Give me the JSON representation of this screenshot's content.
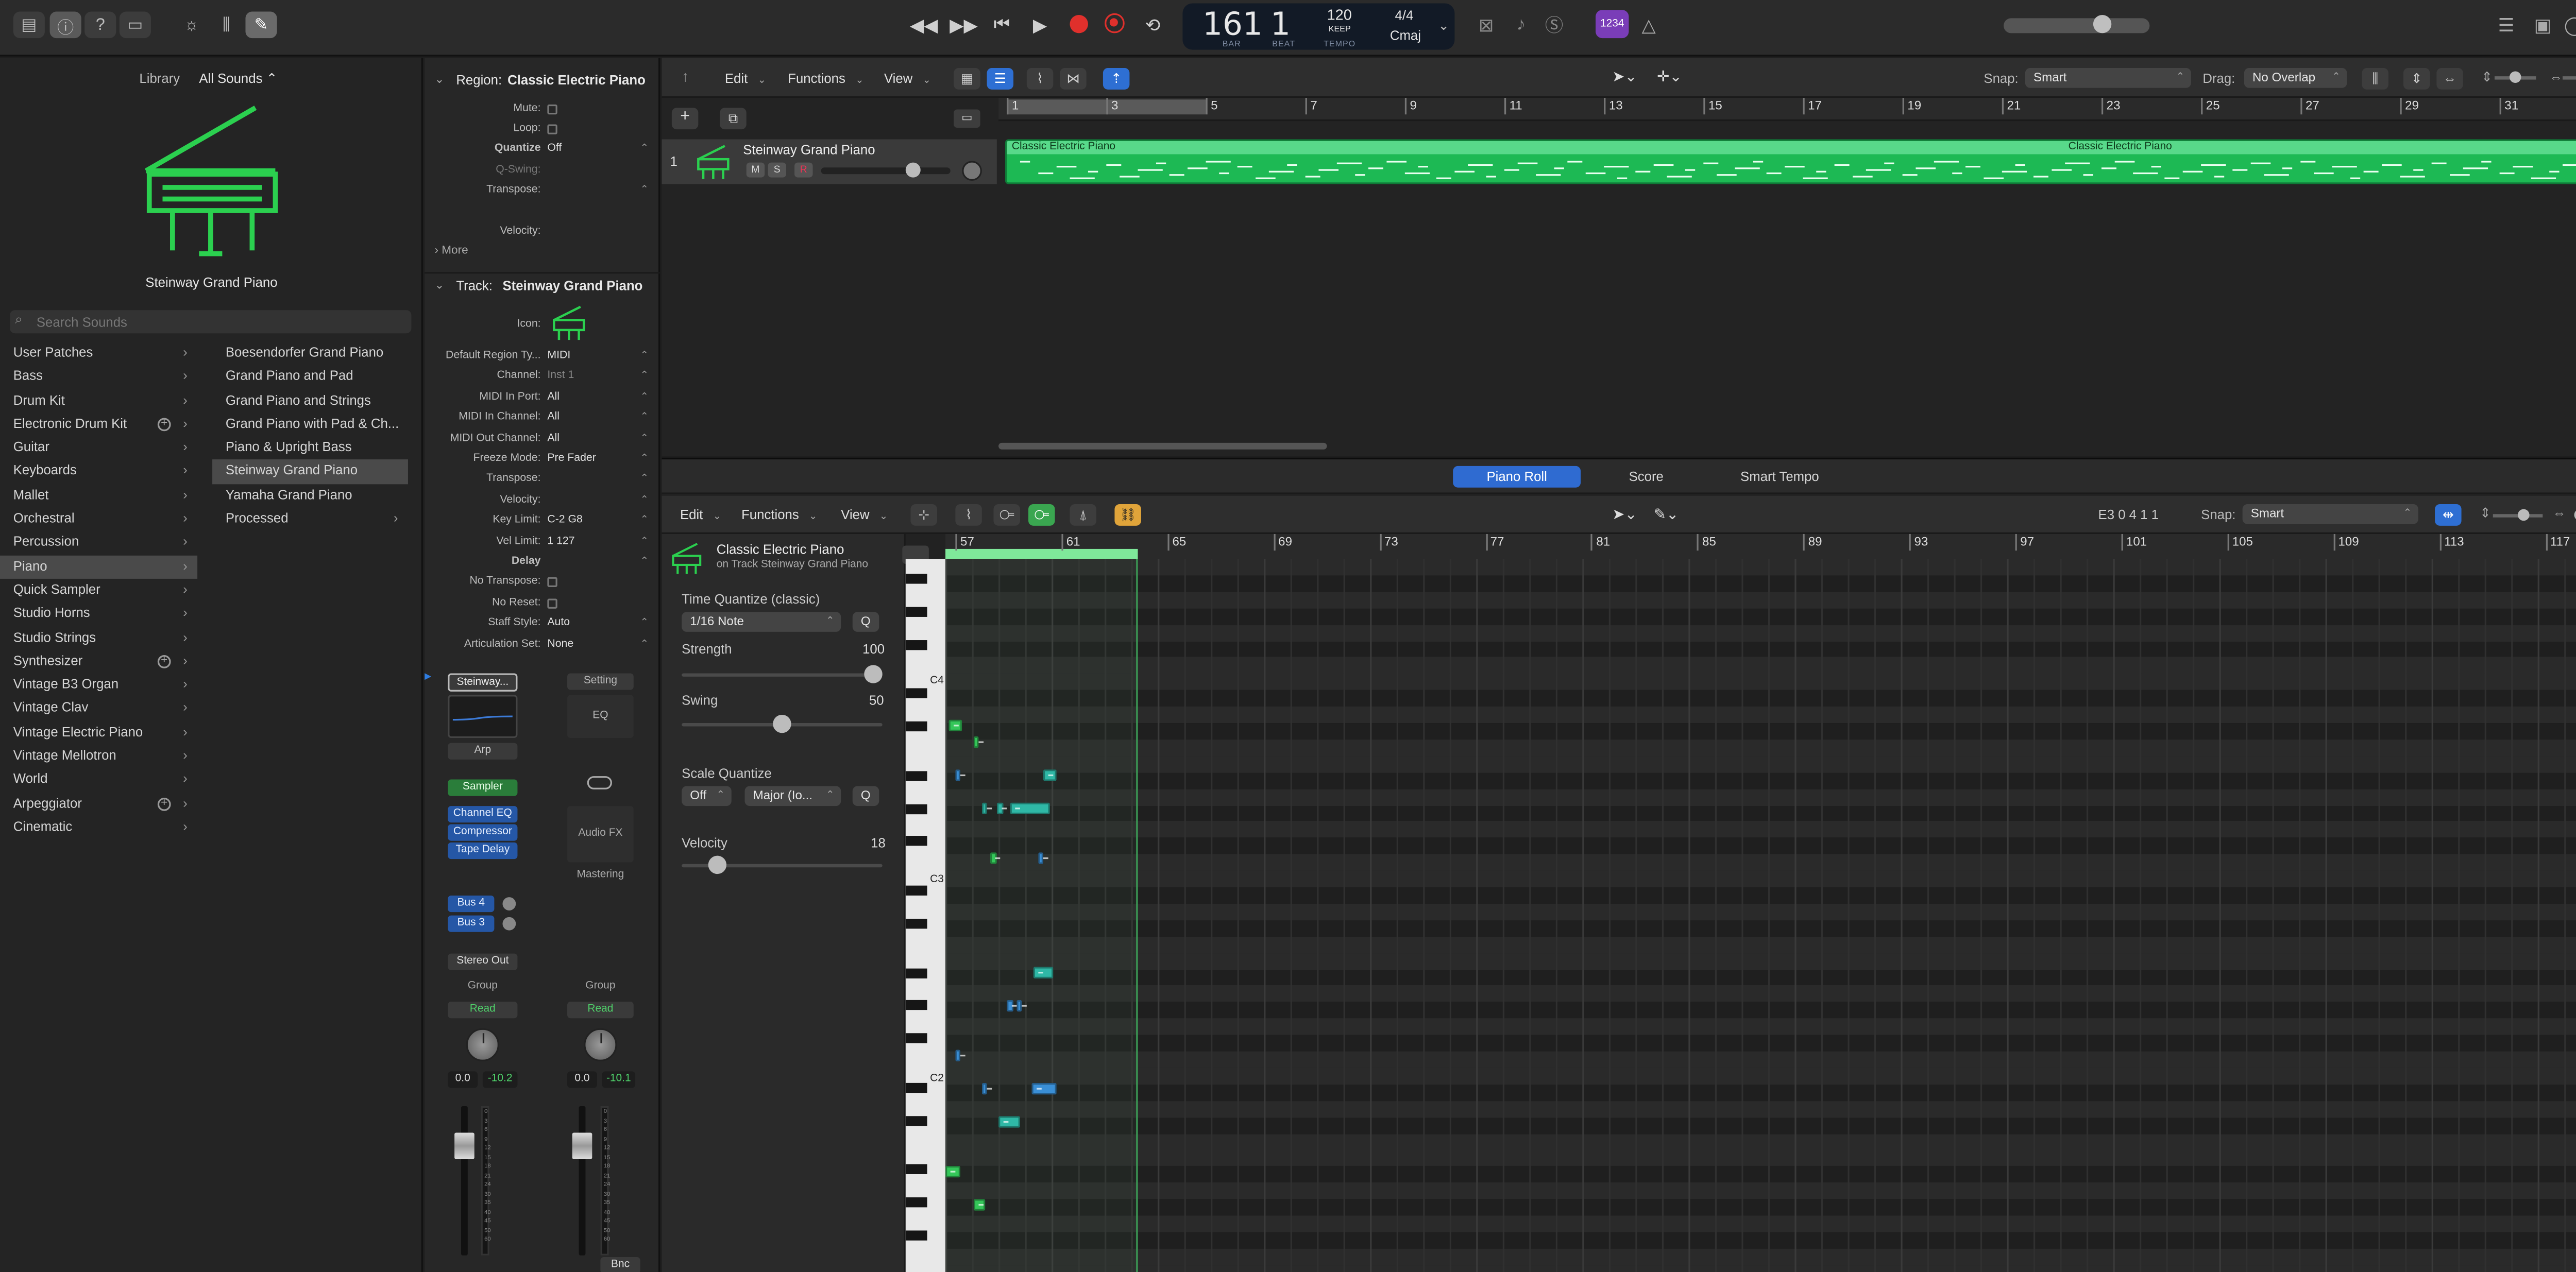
{
  "control_bar": {
    "icons": [
      "library-icon",
      "inspector-icon",
      "help-icon",
      "toolbar-icon",
      "smart-controls-icon",
      "mixer-icon",
      "editors-icon"
    ],
    "transport": [
      "rewind-icon",
      "fast-forward-icon",
      "go-to-beginning-icon",
      "play-icon",
      "record-icon",
      "capture-record-icon",
      "cycle-icon"
    ],
    "lcd": {
      "bar": "161",
      "beat": "1",
      "bar_label": "BAR",
      "beat_label": "BEAT",
      "tempo": "120",
      "tempo_mode": "KEEP",
      "tempo_label": "TEMPO",
      "signature": "4/4",
      "key": "Cmaj"
    },
    "right_badge": "1234"
  },
  "library": {
    "header_label": "Library",
    "header_value": "All Sounds",
    "selected_name": "Steinway Grand Piano",
    "search_placeholder": "Search Sounds",
    "categories": [
      {
        "label": "User Patches"
      },
      {
        "label": "Bass"
      },
      {
        "label": "Drum Kit"
      },
      {
        "label": "Electronic Drum Kit",
        "plus": true
      },
      {
        "label": "Guitar"
      },
      {
        "label": "Keyboards"
      },
      {
        "label": "Mallet"
      },
      {
        "label": "Orchestral"
      },
      {
        "label": "Percussion"
      },
      {
        "label": "Piano",
        "selected": true
      },
      {
        "label": "Quick Sampler"
      },
      {
        "label": "Studio Horns"
      },
      {
        "label": "Studio Strings"
      },
      {
        "label": "Synthesizer",
        "plus": true
      },
      {
        "label": "Vintage B3 Organ"
      },
      {
        "label": "Vintage Clav"
      },
      {
        "label": "Vintage Electric Piano"
      },
      {
        "label": "Vintage Mellotron"
      },
      {
        "label": "World"
      },
      {
        "label": "Arpeggiator",
        "plus": true
      },
      {
        "label": "Cinematic"
      }
    ],
    "patches": [
      {
        "label": "Boesendorfer Grand Piano"
      },
      {
        "label": "Grand Piano and Pad"
      },
      {
        "label": "Grand Piano and Strings"
      },
      {
        "label": "Grand Piano with Pad & Ch..."
      },
      {
        "label": "Piano & Upright Bass"
      },
      {
        "label": "Steinway Grand Piano",
        "selected": true
      },
      {
        "label": "Yamaha Grand Piano"
      },
      {
        "label": "Processed",
        "chevron": true
      }
    ]
  },
  "inspector": {
    "region_header": "Region:",
    "region_name": "Classic Electric Piano",
    "region_rows": [
      {
        "label": "Mute:",
        "type": "check"
      },
      {
        "label": "Loop:",
        "type": "check"
      },
      {
        "label": "Quantize",
        "value": "Off",
        "type": "popup",
        "bold": true
      },
      {
        "label": "Q-Swing:",
        "value": "",
        "type": "dim"
      },
      {
        "label": "Transpose:",
        "value": "",
        "type": "popup"
      },
      {
        "label": "Velocity:",
        "value": "",
        "type": "plain"
      }
    ],
    "more_label": "More",
    "track_header": "Track:",
    "track_name": "Steinway Grand Piano",
    "icon_label": "Icon:",
    "track_rows": [
      {
        "label": "Default Region Ty...",
        "value": "MIDI"
      },
      {
        "label": "Channel:",
        "value": "Inst 1",
        "dim": true
      },
      {
        "label": "MIDI In Port:",
        "value": "All"
      },
      {
        "label": "MIDI In Channel:",
        "value": "All"
      },
      {
        "label": "MIDI Out Channel:",
        "value": "All"
      },
      {
        "label": "Freeze Mode:",
        "value": "Pre Fader"
      },
      {
        "label": "Transpose:",
        "value": ""
      },
      {
        "label": "Velocity:",
        "value": ""
      },
      {
        "label": "Key Limit:",
        "value": "C-2  G8"
      },
      {
        "label": "Vel Limit:",
        "value": "1  127"
      },
      {
        "label": "Delay",
        "value": "",
        "bold": true
      },
      {
        "label": "No Transpose:",
        "value": "",
        "check": true
      },
      {
        "label": "No Reset:",
        "value": "",
        "check": true
      },
      {
        "label": "Staff Style:",
        "value": "Auto"
      },
      {
        "label": "Articulation Set:",
        "value": "None"
      }
    ],
    "strip1": {
      "instrument": "Steinway...",
      "arp": "Arp",
      "sampler": "Sampler",
      "fx": [
        "Channel EQ",
        "Compressor",
        "Tape Delay"
      ],
      "sends": [
        "Bus 4",
        "Bus 3"
      ],
      "output": "Stereo Out",
      "group": "Group",
      "automation": "Read",
      "pan_value": "0.0",
      "level": "-10.2"
    },
    "strip2": {
      "setting": "Setting",
      "eq": "EQ",
      "audio_fx": "Audio FX",
      "mastering": "Mastering",
      "group": "Group",
      "automation": "Read",
      "pan_value": "0.0",
      "level": "-10.1",
      "bounce": "Bnc"
    }
  },
  "tracks": {
    "toolbar": {
      "edit": "Edit",
      "functions": "Functions",
      "view": "View",
      "snap_label": "Snap:",
      "snap_value": "Smart",
      "drag_label": "Drag:",
      "drag_value": "No Overlap"
    },
    "ruler": [
      "1",
      "3",
      "5",
      "7",
      "9",
      "11",
      "13",
      "15",
      "17",
      "19",
      "21",
      "23",
      "25",
      "27",
      "29",
      "31"
    ],
    "track": {
      "number": "1",
      "name": "Steinway Grand Piano",
      "mute": "M",
      "solo": "S",
      "rec": "R"
    },
    "region_label": "Classic Electric Piano",
    "region_label_2": "Classic Electric Piano"
  },
  "editor": {
    "tabs": [
      {
        "label": "Piano Roll",
        "active": true
      },
      {
        "label": "Score"
      },
      {
        "label": "Smart Tempo"
      }
    ],
    "toolbar": {
      "edit": "Edit",
      "functions": "Functions",
      "view": "View",
      "position": "E3   0 4 1 1",
      "snap_label": "Snap:",
      "snap_value": "Smart"
    },
    "region_title": "Classic Electric Piano",
    "region_subtitle": "on Track Steinway Grand Piano",
    "time_quantize_label": "Time Quantize (classic)",
    "time_quantize_value": "1/16 Note",
    "q_button": "Q",
    "strength_label": "Strength",
    "strength_value": "100",
    "swing_label": "Swing",
    "swing_value": "50",
    "scale_quantize_label": "Scale Quantize",
    "scale_off": "Off",
    "scale_mode": "Major (Io...",
    "velocity_label": "Velocity",
    "velocity_value": "18",
    "ruler": [
      "57",
      "61",
      "65",
      "69",
      "73",
      "77",
      "81",
      "85",
      "89",
      "93",
      "97",
      "101",
      "105",
      "109",
      "113",
      "117"
    ],
    "key_labels": [
      "C4",
      "C3",
      "C2"
    ],
    "colors": {
      "green": "#34c759",
      "teal": "#2fb8a6",
      "blue": "#3a8fd6",
      "lightgreen": "#7fe89a"
    }
  }
}
